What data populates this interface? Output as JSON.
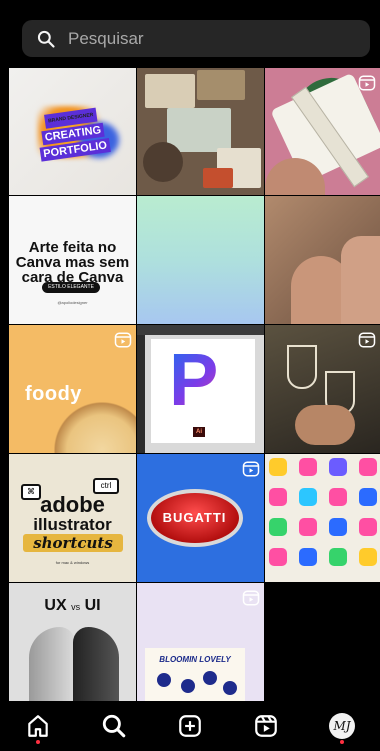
{
  "search": {
    "placeholder": "Pesquisar"
  },
  "grid": {
    "tiles": [
      {
        "id": 1,
        "lines": [
          "BRAND DESIGNER",
          "CREATING",
          "PORTFOLIO"
        ],
        "reel": false
      },
      {
        "id": 2,
        "reel": false
      },
      {
        "id": 3,
        "reel": true
      },
      {
        "id": 4,
        "headline": "Arte feita no Canva mas sem cara de Canva",
        "pill": "ESTILO ELEGANTE",
        "sub": "@apoliodesigner",
        "reel": false
      },
      {
        "id": 5,
        "reel": false
      },
      {
        "id": 6,
        "reel": false
      },
      {
        "id": 7,
        "logo": "foody",
        "reel": true
      },
      {
        "id": 8,
        "letter": "P",
        "ai": "Ai",
        "reel": false
      },
      {
        "id": 9,
        "reel": true
      },
      {
        "id": 10,
        "l1": "adobe",
        "l2": "illustrator",
        "l3": "shortcuts",
        "key1": "⌘",
        "key2": "ctrl",
        "foot": "for mac & windows",
        "reel": false
      },
      {
        "id": 11,
        "brand": "BUGATTI",
        "reel": true
      },
      {
        "id": 12,
        "reel": false
      },
      {
        "id": 13,
        "ux": "UX",
        "vs": "vs",
        "ui": "UI",
        "reel": false
      },
      {
        "id": 14,
        "text": "BLOOMIN LOVELY",
        "reel": true
      }
    ]
  },
  "nav": {
    "items": [
      "home-icon",
      "search-icon",
      "create-icon",
      "reels-icon",
      "profile-avatar"
    ],
    "avatar_text": "MJ"
  },
  "colors": {
    "background": "#000000",
    "search_bg": "#262626",
    "notification_dot": "#ff3040"
  }
}
